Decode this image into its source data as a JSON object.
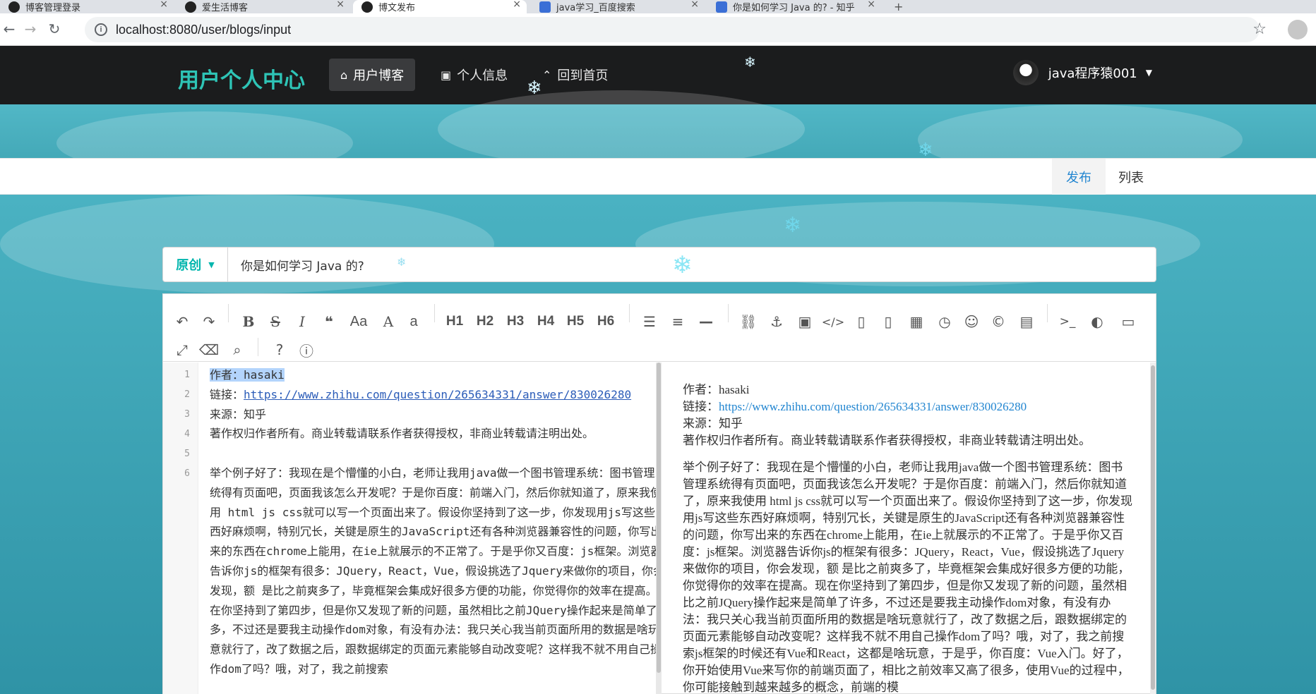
{
  "browser": {
    "tabs": [
      {
        "title": "博客管理登录"
      },
      {
        "title": "爱生活博客"
      },
      {
        "title": "博文发布"
      },
      {
        "title": "java学习_百度搜索"
      },
      {
        "title": "你是如何学习 Java 的? - 知乎"
      }
    ],
    "url": "localhost:8080/user/blogs/input"
  },
  "header": {
    "brand": "用户个人中心",
    "menu": [
      {
        "label": "用户博客",
        "icon": "home-icon"
      },
      {
        "label": "个人信息",
        "icon": "image-icon"
      },
      {
        "label": "回到首页",
        "icon": "up-arrow-icon"
      }
    ],
    "username": "java程序猿001"
  },
  "subnav": {
    "publish": "发布",
    "list": "列表"
  },
  "form": {
    "type_label": "原创",
    "title_value": "你是如何学习 Java 的?"
  },
  "toolbar": {
    "headings": [
      "H1",
      "H2",
      "H3",
      "H4",
      "H5",
      "H6"
    ]
  },
  "editor": {
    "line_numbers": [
      "1",
      "2",
      "3",
      "4",
      "5",
      "6"
    ],
    "line1": "作者：hasaki",
    "line2_prefix": "链接：",
    "line2_link": "https://www.zhihu.com/question/265634331/answer/830026280",
    "line3": "来源：知乎",
    "line4": "著作权归作者所有。商业转载请联系作者获得授权，非商业转载请注明出处。",
    "line6": "举个例子好了：我现在是个懵懂的小白，老师让我用java做一个图书管理系统：图书管理系统得有页面吧，页面我该怎么开发呢？于是你百度：前端入门，然后你就知道了，原来我使用 html js css就可以写一个页面出来了。假设你坚持到了这一步，你发现用js写这些东西好麻烦啊，特别冗长，关键是原生的JavaScript还有各种浏览器兼容性的问题，你写出来的东西在chrome上能用，在ie上就展示的不正常了。于是乎你又百度：js框架。浏览器告诉你js的框架有很多：JQuery，React，Vue，假设挑选了Jquery来做你的项目，你会发现，额 是比之前爽多了，毕竟框架会集成好很多方便的功能，你觉得你的效率在提高。现在你坚持到了第四步，但是你又发现了新的问题，虽然相比之前JQuery操作起来是简单了许多，不过还是要我主动操作dom对象，有没有办法：我只关心我当前页面所用的数据是啥玩意就行了，改了数据之后，跟数据绑定的页面元素能够自动改变呢？这样我不就不用自己操作dom了吗？哦，对了，我之前搜索"
  },
  "preview": {
    "author": "作者：hasaki",
    "link_prefix": "链接：",
    "link": "https://www.zhihu.com/question/265634331/answer/830026280",
    "source": "来源：知乎",
    "copyright": "著作权归作者所有。商业转载请联系作者获得授权，非商业转载请注明出处。",
    "body": "举个例子好了：我现在是个懵懂的小白，老师让我用java做一个图书管理系统：图书管理系统得有页面吧，页面我该怎么开发呢？于是你百度：前端入门，然后你就知道了，原来我使用 html js css就可以写一个页面出来了。假设你坚持到了这一步，你发现用js写这些东西好麻烦啊，特别冗长，关键是原生的JavaScript还有各种浏览器兼容性的问题，你写出来的东西在chrome上能用，在ie上就展示的不正常了。于是乎你又百度：js框架。浏览器告诉你js的框架有很多：JQuery，React，Vue，假设挑选了Jquery来做你的项目，你会发现，额 是比之前爽多了，毕竟框架会集成好很多方便的功能，你觉得你的效率在提高。现在你坚持到了第四步，但是你又发现了新的问题，虽然相比之前JQuery操作起来是简单了许多，不过还是要我主动操作dom对象，有没有办法：我只关心我当前页面所用的数据是啥玩意就行了，改了数据之后，跟数据绑定的页面元素能够自动改变呢？这样我不就不用自己操作dom了吗？哦，对了，我之前搜索js框架的时候还有Vue和React，这都是啥玩意，于是乎，你百度：Vue入门。好了，你开始使用Vue来写你的前端页面了，相比之前效率又高了很多，使用Vue的过程中，你可能接触到越来越多的概念，前端的模"
  }
}
